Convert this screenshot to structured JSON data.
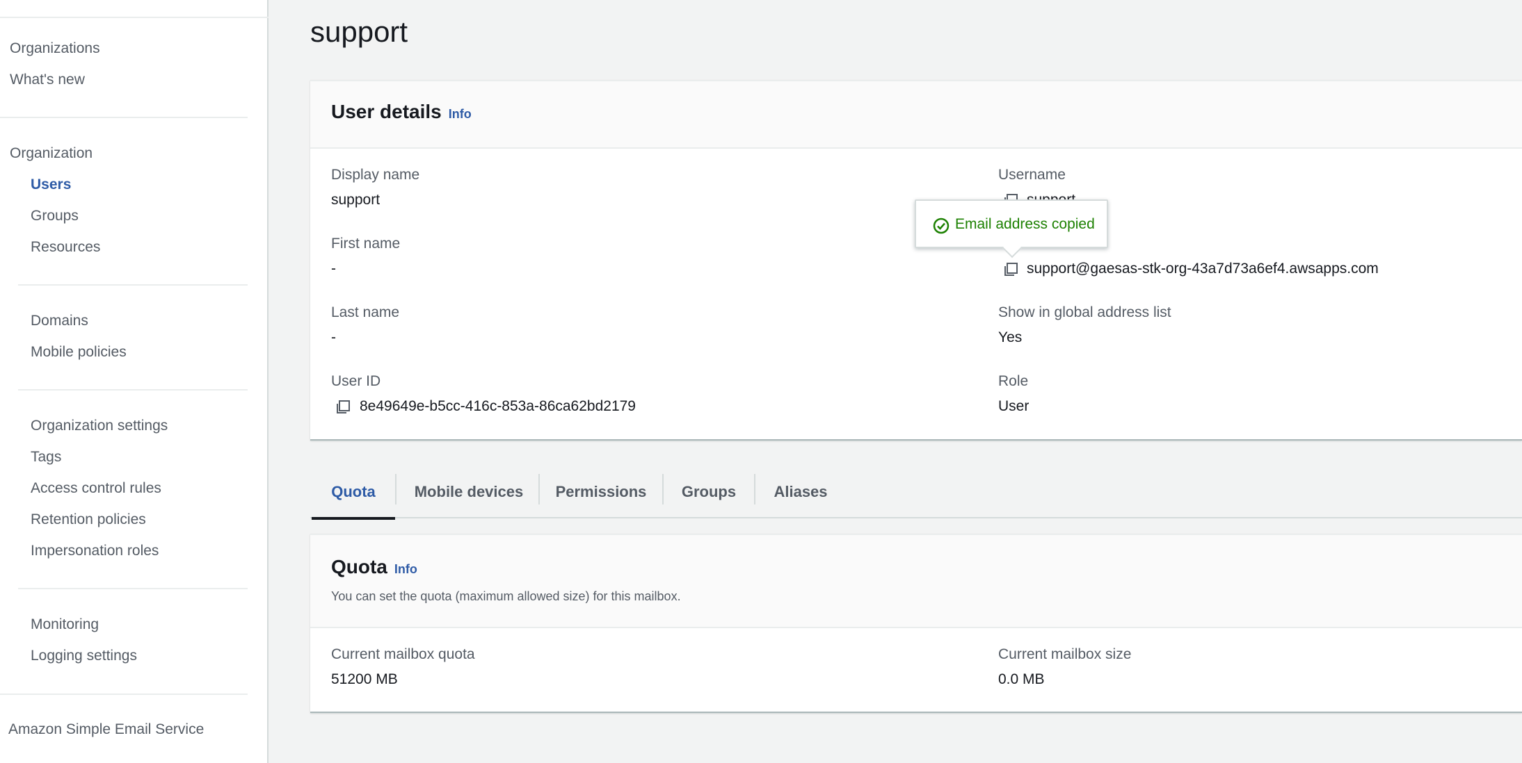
{
  "sidebar": {
    "top_items": [
      "Organizations",
      "What's new"
    ],
    "organization_heading": "Organization",
    "org_items": [
      "Users",
      "Groups",
      "Resources"
    ],
    "domain_items": [
      "Domains",
      "Mobile policies"
    ],
    "settings_items": [
      "Organization settings",
      "Tags",
      "Access control rules",
      "Retention policies",
      "Impersonation roles"
    ],
    "monitoring_items": [
      "Monitoring",
      "Logging settings"
    ],
    "footer_item": "Amazon Simple Email Service",
    "active_item": "Users"
  },
  "page": {
    "title": "support"
  },
  "user_details": {
    "title": "User details",
    "info_label": "Info",
    "display_name_label": "Display name",
    "display_name_value": "support",
    "first_name_label": "First name",
    "first_name_value": "-",
    "last_name_label": "Last name",
    "last_name_value": "-",
    "user_id_label": "User ID",
    "user_id_value": "8e49649e-b5cc-416c-853a-86ca62bd2179",
    "username_label": "Username",
    "username_value": "support",
    "email_value": "support@gaesas-stk-org-43a7d73a6ef4.awsapps.com",
    "global_list_label": "Show in global address list",
    "global_list_value": "Yes",
    "role_label": "Role",
    "role_value": "User"
  },
  "tooltip": {
    "message": "Email address copied"
  },
  "tabs": [
    "Quota",
    "Mobile devices",
    "Permissions",
    "Groups",
    "Aliases"
  ],
  "active_tab": "Quota",
  "quota": {
    "title": "Quota",
    "info_label": "Info",
    "description": "You can set the quota (maximum allowed size) for this mailbox.",
    "current_quota_label": "Current mailbox quota",
    "current_quota_value": "51200 MB",
    "current_size_label": "Current mailbox size",
    "current_size_value": "0.0 MB"
  },
  "colors": {
    "link": "#2e5ba6",
    "success": "#1d8102"
  }
}
